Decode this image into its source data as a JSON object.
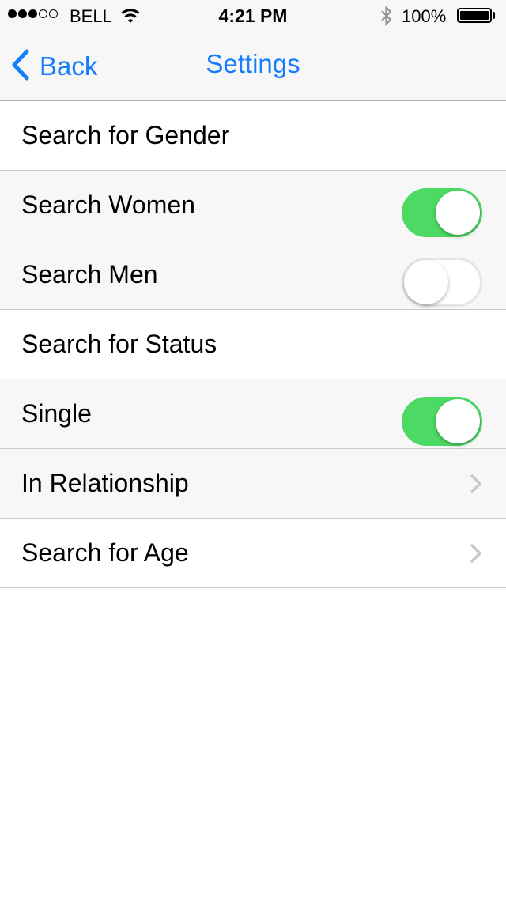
{
  "status_bar": {
    "signal_filled": 3,
    "signal_empty": 2,
    "carrier": "BELL",
    "time": "4:21 PM",
    "battery": "100%",
    "icons": [
      "wifi-icon",
      "bluetooth-icon",
      "battery-icon"
    ]
  },
  "nav": {
    "back_label": "Back",
    "title": "Settings"
  },
  "rows": [
    {
      "label": "Search for Gender",
      "type": "header"
    },
    {
      "label": "Search Women",
      "type": "toggle",
      "on": true
    },
    {
      "label": "Search Men",
      "type": "toggle",
      "on": false
    },
    {
      "label": "Search for Status",
      "type": "header"
    },
    {
      "label": "Single",
      "type": "toggle",
      "on": true
    },
    {
      "label": "In Relationship",
      "type": "disclosure"
    },
    {
      "label": "Search for Age",
      "type": "disclosure"
    }
  ],
  "colors": {
    "accent": "#157efb",
    "switch_on": "#4cd964"
  }
}
